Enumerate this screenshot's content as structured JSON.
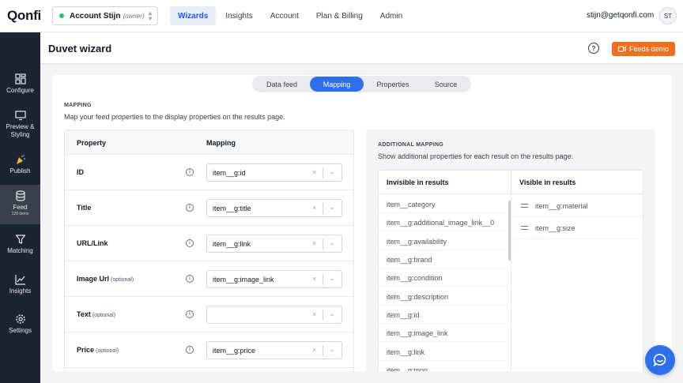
{
  "app": {
    "logo": "Qonfi"
  },
  "header": {
    "account": {
      "name": "Account Stijn",
      "role": "(owner)",
      "status_color": "#22c55e"
    },
    "nav": [
      {
        "label": "Wizards",
        "active": true
      },
      {
        "label": "Insights",
        "active": false
      },
      {
        "label": "Account",
        "active": false
      },
      {
        "label": "Plan & Billing",
        "active": false
      },
      {
        "label": "Admin",
        "active": false
      }
    ],
    "user_email": "stijn@getqonfi.com",
    "user_initials": "ST"
  },
  "sidebar": {
    "items": [
      {
        "label": "Configure",
        "icon": "configure-icon"
      },
      {
        "label": "Preview & Styling",
        "icon": "monitor-icon"
      },
      {
        "label": "Publish",
        "icon": "party-popper-icon"
      },
      {
        "label": "Feed",
        "sub": "128 items",
        "icon": "database-icon",
        "active": true
      },
      {
        "label": "Matching",
        "icon": "funnel-icon"
      },
      {
        "label": "Insights",
        "icon": "chart-icon"
      },
      {
        "label": "Settings",
        "icon": "gear-icon"
      }
    ]
  },
  "page": {
    "title": "Duvet wizard",
    "help": "?",
    "demo_button": "Feeds demo",
    "accent_color": "#f07022"
  },
  "tabs": [
    {
      "label": "Data feed",
      "active": false
    },
    {
      "label": "Mapping",
      "active": true
    },
    {
      "label": "Properties",
      "active": false
    },
    {
      "label": "Source",
      "active": false
    }
  ],
  "mapping": {
    "section_label": "MAPPING",
    "description": "Map your feed properties to the display properties on the results page.",
    "columns": {
      "property": "Property",
      "mapping": "Mapping"
    },
    "rows": [
      {
        "property": "ID",
        "optional": "",
        "value": "item__g:id"
      },
      {
        "property": "Title",
        "optional": "",
        "value": "item__g:title"
      },
      {
        "property": "URL/Link",
        "optional": "",
        "value": "item__g:link"
      },
      {
        "property": "Image Url",
        "optional": "(optional)",
        "value": "item__g:image_link"
      },
      {
        "property": "Text",
        "optional": "(optional)",
        "value": ""
      },
      {
        "property": "Price",
        "optional": "(optional)",
        "value": "item__g:price"
      }
    ],
    "clear_glyph": "×",
    "caret_glyph": "⌄"
  },
  "additional_mapping": {
    "section_label": "ADDITIONAL MAPPING",
    "description": "Show additional properties for each result on the results page.",
    "invisible_header": "Invisible in results",
    "visible_header": "Visible in results",
    "invisible": [
      "item__category",
      "item__g:additional_image_link__0",
      "item__g:availability",
      "item__g:brand",
      "item__g:condition",
      "item__g:description",
      "item__g:id",
      "item__g:image_link",
      "item__g:link",
      "item__g:mpn"
    ],
    "visible": [
      "item__g:material",
      "item__g:size"
    ]
  },
  "chat": {
    "icon": "chat-bubble-icon",
    "color": "#2e6fec"
  }
}
